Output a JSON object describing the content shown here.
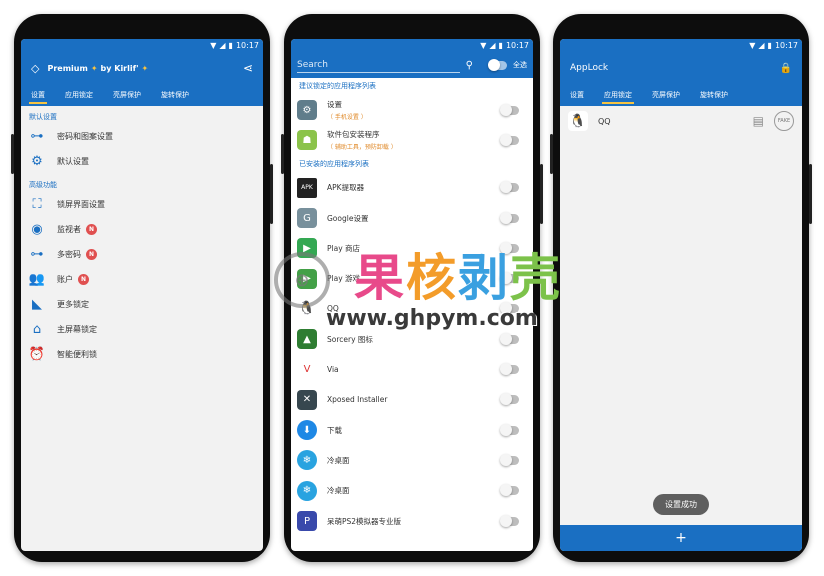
{
  "status": {
    "time": "10:17"
  },
  "phone1": {
    "title": "Premium",
    "author": "by Kirlif'",
    "tabs": [
      "设置",
      "应用锁定",
      "亮屏保护",
      "旋转保护"
    ],
    "sections": [
      {
        "header": "默认设置",
        "items": [
          {
            "icon": "key-icon",
            "label": "密码和图案设置",
            "badge": ""
          },
          {
            "icon": "gear-icon",
            "label": "默认设置",
            "badge": ""
          }
        ]
      },
      {
        "header": "高级功能",
        "items": [
          {
            "icon": "screen-frame-icon",
            "label": "锁屏界面设置",
            "badge": ""
          },
          {
            "icon": "eye-icon",
            "label": "监视者",
            "badge": "N"
          },
          {
            "icon": "multi-key-icon",
            "label": "多密码",
            "badge": "N"
          },
          {
            "icon": "people-icon",
            "label": "账户",
            "badge": "N"
          },
          {
            "icon": "wifi-lock-icon",
            "label": "更多锁定",
            "badge": ""
          },
          {
            "icon": "home-icon",
            "label": "主屏幕锁定",
            "badge": ""
          },
          {
            "icon": "alarm-icon",
            "label": "智能便利锁",
            "badge": ""
          }
        ]
      }
    ]
  },
  "phone2": {
    "search_placeholder": "Search",
    "select_all": "全选",
    "suggested_header": "建议锁定的应用程序列表",
    "suggested": [
      {
        "icon": "settings-app-icon",
        "label": "设置",
        "sub": "（ 手机设置 ）",
        "color": "#607d8b"
      },
      {
        "icon": "android-app-icon",
        "label": "软件包安装程序",
        "sub": "（ 辅助工具，预防卸载 ）",
        "color": "#8bc34a"
      }
    ],
    "installed_header": "已安装的应用程序列表",
    "installed": [
      {
        "icon": "apk-backup-app-icon",
        "label": "APK提取器",
        "color": "#222222"
      },
      {
        "icon": "google-settings-app-icon",
        "label": "Google设置",
        "color": "#78909c"
      },
      {
        "icon": "play-store-app-icon",
        "label": "Play 商店",
        "color": "#34a853"
      },
      {
        "icon": "play-games-app-icon",
        "label": "Play 游戏",
        "color": "#43a047"
      },
      {
        "icon": "qq-app-icon",
        "label": "QQ",
        "color": "#ffffff"
      },
      {
        "icon": "sorcery-app-icon",
        "label": "Sorcery 图标",
        "color": "#2e7d32"
      },
      {
        "icon": "via-app-icon",
        "label": "Via",
        "color": "#ffffff"
      },
      {
        "icon": "xposed-app-icon",
        "label": "Xposed Installer",
        "color": "#37474f"
      },
      {
        "icon": "download-app-icon",
        "label": "下载",
        "color": "#1e88e5"
      },
      {
        "icon": "freeze-app-icon",
        "label": "冷桌面",
        "color": "#29a3e0"
      },
      {
        "icon": "freeze-app-icon-2",
        "label": "冷桌面",
        "color": "#29a3e0"
      },
      {
        "icon": "ps2-app-icon",
        "label": "呆萌PS2模拟器专业版",
        "color": "#3949ab"
      }
    ]
  },
  "phone3": {
    "title": "AppLock",
    "tabs": [
      "设置",
      "应用锁定",
      "亮屏保护",
      "旋转保护"
    ],
    "locked_app": "QQ",
    "fake_label": "FAKE",
    "toast": "设置成功",
    "add_label": "+"
  },
  "watermark": {
    "chars": [
      "果",
      "核",
      "剥",
      "壳"
    ],
    "url": "www.ghpym.com"
  }
}
